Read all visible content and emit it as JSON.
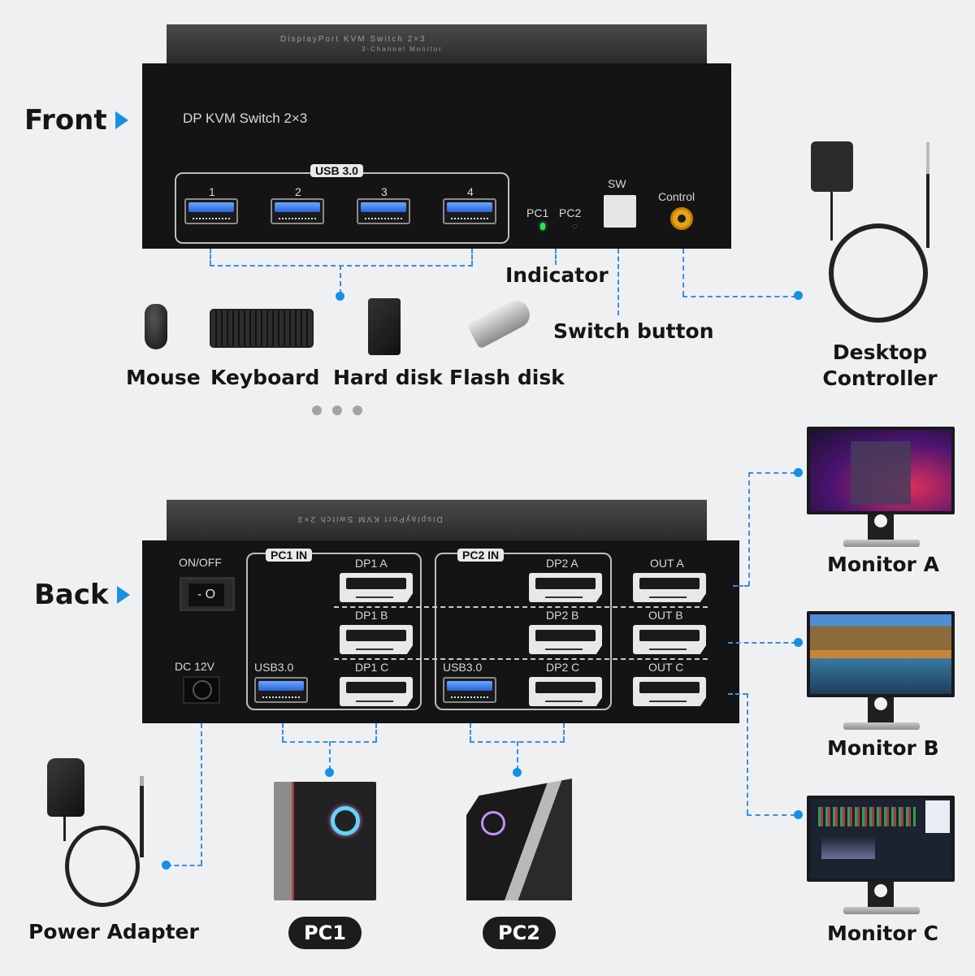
{
  "sections": {
    "front_label": "Front",
    "back_label": "Back"
  },
  "front": {
    "top_etching_line1": "DisplayPort KVM Switch 2×3",
    "top_etching_line2": "3-Channel Monitor",
    "model_text": "DP KVM Switch 2×3",
    "usb_group_label": "USB 3.0",
    "usb_ports": [
      "1",
      "2",
      "3",
      "4"
    ],
    "indicator_labels": [
      "PC1",
      "PC2"
    ],
    "switch_label": "SW",
    "control_label": "Control"
  },
  "front_callouts": {
    "indicator": "Indicator",
    "switch_button": "Switch button",
    "desktop_controller": "Desktop Controller",
    "peripherals": [
      "Mouse",
      "Keyboard",
      "Hard disk",
      "Flash disk"
    ],
    "more_dots": "• • •"
  },
  "back": {
    "power_switch_label": "ON/OFF",
    "power_switch_glyph": "- O",
    "dc_label": "DC 12V",
    "pc1_group_label": "PC1 IN",
    "pc2_group_label": "PC2 IN",
    "pc1_usb_label": "USB3.0",
    "pc2_usb_label": "USB3.0",
    "pc1_ports": [
      "DP1 A",
      "DP1 B",
      "DP1 C"
    ],
    "pc2_ports": [
      "DP2 A",
      "DP2 B",
      "DP2 C"
    ],
    "out_ports": [
      "OUT A",
      "OUT B",
      "OUT C"
    ]
  },
  "back_callouts": {
    "power_adapter": "Power Adapter",
    "pc1": "PC1",
    "pc2": "PC2",
    "monitors": [
      "Monitor A",
      "Monitor B",
      "Monitor C"
    ]
  },
  "colors": {
    "accent": "#1690e6",
    "background": "#eef0f2",
    "device": "#141414",
    "indicator_led_on": "#2ee35a"
  }
}
